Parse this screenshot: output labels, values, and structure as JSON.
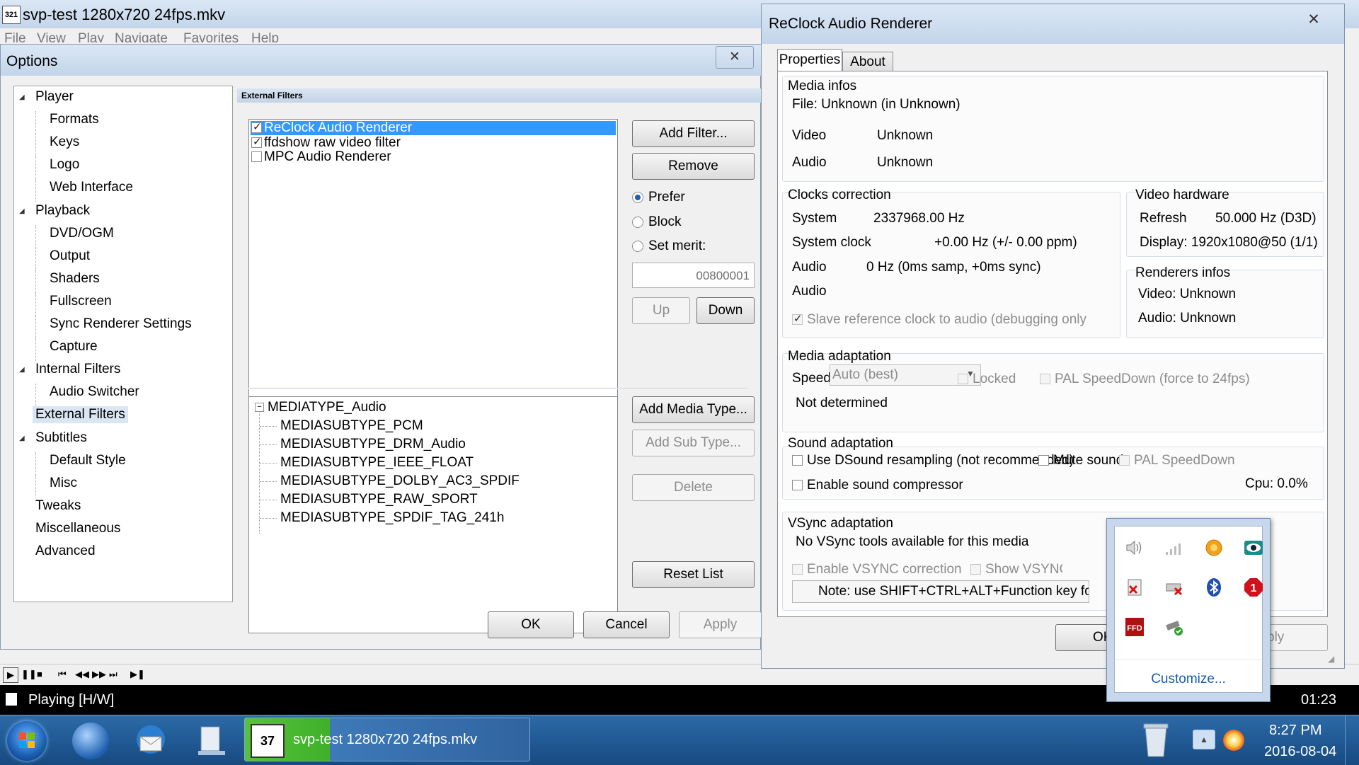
{
  "mpc": {
    "title": "svp-test 1280x720 24fps.mkv",
    "menu": [
      "File",
      "View",
      "Play",
      "Navigate",
      "Favorites",
      "Help"
    ],
    "status": "Playing [H/W]",
    "time": "01:23"
  },
  "options": {
    "title": "Options",
    "tree": [
      {
        "label": "Player",
        "level": 0,
        "expander": true
      },
      {
        "label": "Formats",
        "level": 1
      },
      {
        "label": "Keys",
        "level": 1
      },
      {
        "label": "Logo",
        "level": 1
      },
      {
        "label": "Web Interface",
        "level": 1
      },
      {
        "label": "Playback",
        "level": 0,
        "expander": true
      },
      {
        "label": "DVD/OGM",
        "level": 1
      },
      {
        "label": "Output",
        "level": 1
      },
      {
        "label": "Shaders",
        "level": 1
      },
      {
        "label": "Fullscreen",
        "level": 1
      },
      {
        "label": "Sync Renderer Settings",
        "level": 1
      },
      {
        "label": "Capture",
        "level": 1
      },
      {
        "label": "Internal Filters",
        "level": 0,
        "expander": true
      },
      {
        "label": "Audio Switcher",
        "level": 1
      },
      {
        "label": "External Filters",
        "level": 0,
        "selected": true
      },
      {
        "label": "Subtitles",
        "level": 0,
        "expander": true
      },
      {
        "label": "Default Style",
        "level": 1
      },
      {
        "label": "Misc",
        "level": 1
      },
      {
        "label": "Tweaks",
        "level": 0
      },
      {
        "label": "Miscellaneous",
        "level": 0
      },
      {
        "label": "Advanced",
        "level": 0
      }
    ],
    "section_header": "External Filters",
    "filters": [
      {
        "label": "ReClock Audio Renderer",
        "checked": true,
        "selected": true
      },
      {
        "label": "ffdshow raw video filter",
        "checked": true
      },
      {
        "label": "MPC Audio Renderer",
        "checked": false
      }
    ],
    "add_filter": "Add Filter...",
    "remove": "Remove",
    "prefer": "Prefer",
    "block": "Block",
    "set_merit": "Set merit:",
    "merit_value": "00800001",
    "up": "Up",
    "down": "Down",
    "media_root": "MEDIATYPE_Audio",
    "media_subtypes": [
      "MEDIASUBTYPE_PCM",
      "MEDIASUBTYPE_DRM_Audio",
      "MEDIASUBTYPE_IEEE_FLOAT",
      "MEDIASUBTYPE_DOLBY_AC3_SPDIF",
      "MEDIASUBTYPE_RAW_SPORT",
      "MEDIASUBTYPE_SPDIF_TAG_241h"
    ],
    "add_media_type": "Add Media Type...",
    "add_sub_type": "Add Sub Type...",
    "delete": "Delete",
    "reset_list": "Reset List",
    "ok": "OK",
    "cancel": "Cancel",
    "apply": "Apply"
  },
  "reclock": {
    "title": "ReClock Audio Renderer",
    "tabs": [
      "Properties",
      "About"
    ],
    "media_infos": "Media infos",
    "file": "File:  Unknown (in Unknown)",
    "video_label": "Video",
    "video_value": "Unknown",
    "audio_label": "Audio",
    "audio_value": "Unknown",
    "clocks_correction": "Clocks correction",
    "system_label": "System",
    "system_value": "2337968.00 Hz",
    "system_clock_label": "System clock",
    "system_clock_value": "+0.00 Hz (+/- 0.00 ppm)",
    "audio_clock_label": "Audio",
    "audio_clock_value": "0 Hz (0ms samp, +0ms sync)",
    "audio2_label": "Audio",
    "slave_ref": "Slave reference clock to audio (debugging only",
    "video_hardware": "Video hardware",
    "refresh_label": "Refresh",
    "refresh_value": "50.000 Hz (D3D)",
    "display": "Display: 1920x1080@50 (1/1)",
    "renderers_infos": "Renderers infos",
    "renderer_video": "Video: Unknown",
    "renderer_audio": "Audio: Unknown",
    "media_adaptation": "Media adaptation",
    "speed_label": "Speed:",
    "speed_value": "Auto (best)",
    "locked": "Locked",
    "pal_speeddown_force": "PAL SpeedDown (force to 24fps)",
    "not_determined": "Not determined",
    "sound_adaptation": "Sound adaptation",
    "use_dsound": "Use DSound resampling (not recommended)",
    "mute_sound": "Mute sound",
    "pal_speeddown": "PAL SpeedDown",
    "enable_compressor": "Enable sound compressor",
    "cpu": "Cpu: 0.0%",
    "vsync_adaptation": "VSync adaptation",
    "no_vsync": "No VSync tools available for this media",
    "enable_vsync": "Enable VSYNC correction",
    "show_vsync": "Show VSYNC on scr",
    "note": "Note: use SHIFT+CTRL+ALT+Function key for",
    "ok": "OK",
    "apply": "ply"
  },
  "tray_popup": {
    "customize": "Customize...",
    "icons": [
      "speaker-icon",
      "network-signal-icon",
      "orange-app-icon",
      "eye-icon",
      "clipboard-x-icon",
      "drive-x-icon",
      "bluetooth-icon",
      "alert-shield-icon",
      "ffdshow-icon",
      "usb-drive-icon"
    ]
  },
  "taskbar": {
    "task_label": "svp-test 1280x720 24fps.mkv",
    "clock_time": "8:27 PM",
    "clock_date": "2016-08-04"
  },
  "colors": {
    "selection": "#3399ff",
    "taskbar": "#1b4f86",
    "link": "#1a5db1"
  }
}
